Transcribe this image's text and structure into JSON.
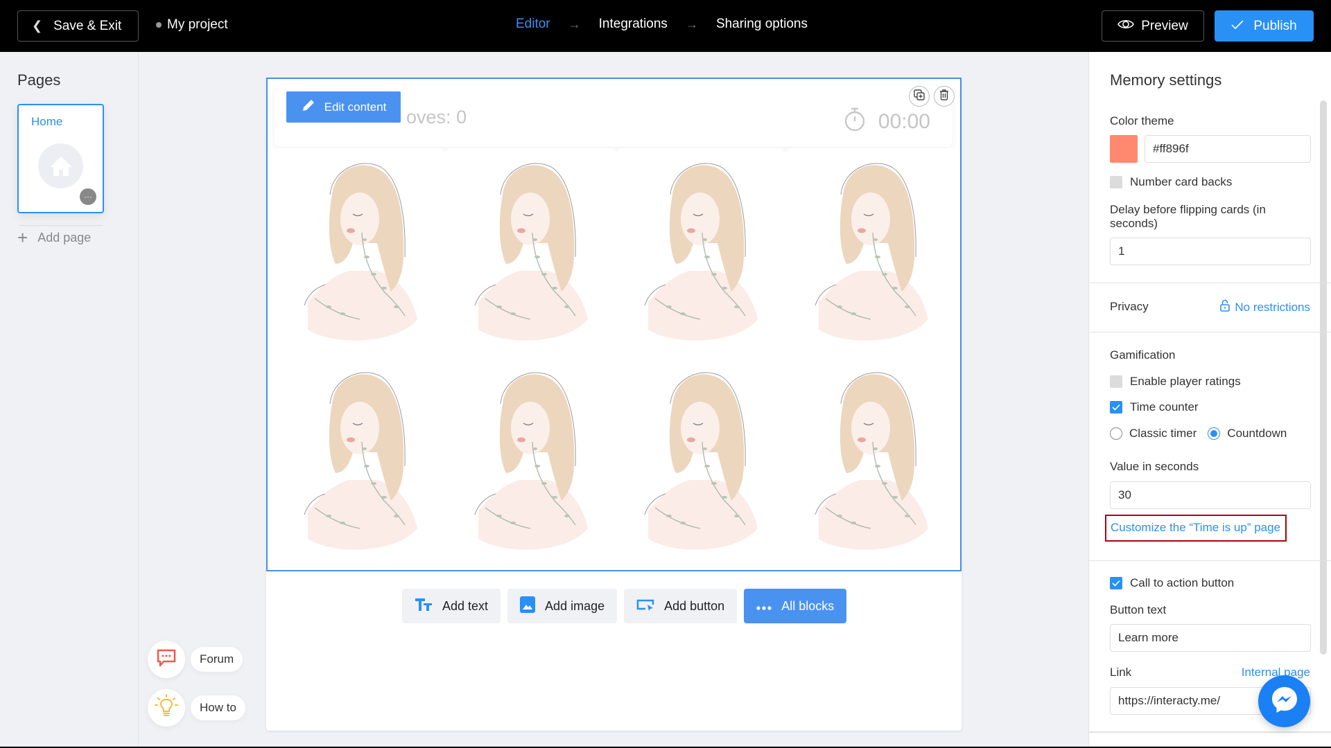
{
  "header": {
    "save_exit_label": "Save & Exit",
    "project_name": "My project",
    "steps": [
      {
        "label": "Editor",
        "active": true
      },
      {
        "label": "Integrations",
        "active": false
      },
      {
        "label": "Sharing options",
        "active": false
      }
    ],
    "step_arrow": "→",
    "preview_label": "Preview",
    "publish_label": "Publish"
  },
  "sidebar": {
    "title": "Pages",
    "pages": [
      {
        "label": "Home",
        "icon": "home-icon",
        "selected": true
      }
    ],
    "add_page_label": "Add page"
  },
  "help": {
    "forum_label": "Forum",
    "howto_label": "How to"
  },
  "canvas": {
    "edit_content_label": "Edit content",
    "moves_label": "oves:",
    "moves_value": "0",
    "timer_value": "00:00",
    "card_count": 8,
    "card_image": "girl-with-leaves-illustration",
    "add_buttons": [
      {
        "label": "Add text",
        "icon": "text-icon",
        "primary": false
      },
      {
        "label": "Add image",
        "icon": "image-icon",
        "primary": false
      },
      {
        "label": "Add button",
        "icon": "button-icon",
        "primary": false
      },
      {
        "label": "All blocks",
        "icon": "more-dots-icon",
        "primary": true
      }
    ]
  },
  "settings": {
    "title": "Memory settings",
    "color_theme_label": "Color theme",
    "color_theme_value": "#ff896f",
    "number_card_backs_label": "Number card backs",
    "number_card_backs_checked": false,
    "delay_label": "Delay before flipping cards (in seconds)",
    "delay_value": "1",
    "privacy_label": "Privacy",
    "privacy_value": "No restrictions",
    "gamification_label": "Gamification",
    "player_ratings_label": "Enable player ratings",
    "player_ratings_checked": false,
    "time_counter_label": "Time counter",
    "time_counter_checked": true,
    "timer_modes": [
      {
        "label": "Classic timer",
        "selected": false
      },
      {
        "label": "Countdown",
        "selected": true
      }
    ],
    "value_seconds_label": "Value in seconds",
    "value_seconds": "30",
    "customize_link": "Customize the “Time is up” page",
    "cta_label": "Call to action button",
    "cta_checked": true,
    "button_text_label": "Button text",
    "button_text_value": "Learn more",
    "link_label": "Link",
    "internal_page_label": "Internal page",
    "link_value": "https://interacty.me/"
  },
  "colors": {
    "accent": "#2990f5",
    "header_bg": "#000000",
    "highlight_box": "#b3000c",
    "swatch": "#ff896f"
  }
}
